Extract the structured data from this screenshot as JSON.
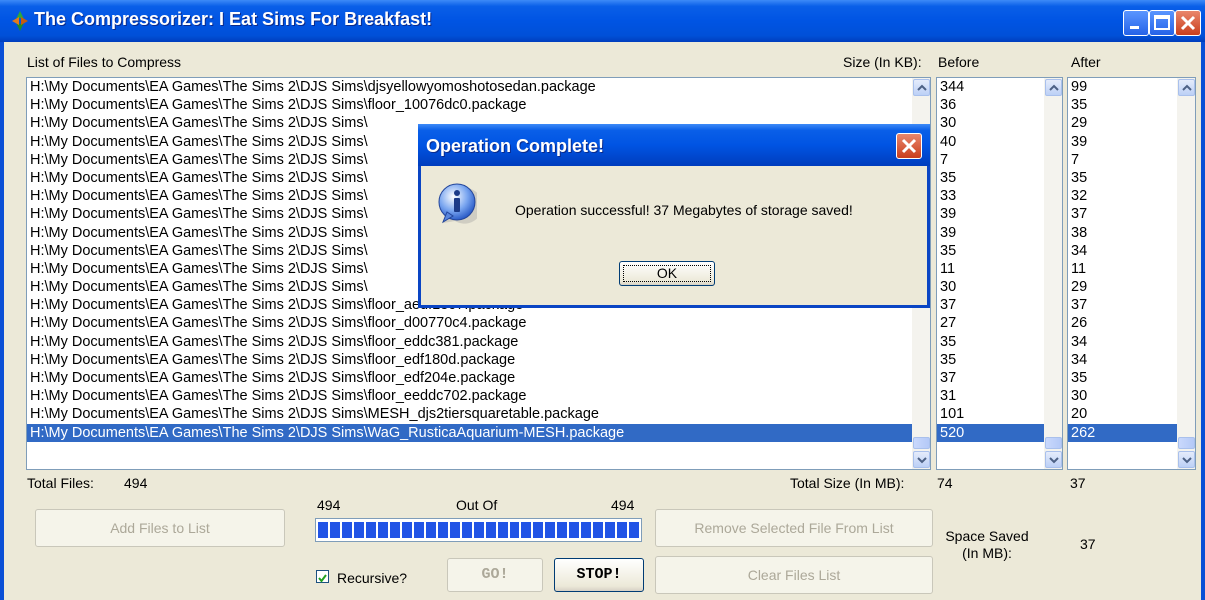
{
  "window": {
    "title": "The Compressorizer: I Eat Sims For Breakfast!"
  },
  "headers": {
    "files": "List of Files to Compress",
    "size": "Size (In KB):",
    "before": "Before",
    "after": "After"
  },
  "files": [
    "H:\\My Documents\\EA Games\\The Sims 2\\DJS Sims\\djsyellowyomoshotosedan.package",
    "H:\\My Documents\\EA Games\\The Sims 2\\DJS Sims\\floor_10076dc0.package",
    "H:\\My Documents\\EA Games\\The Sims 2\\DJS Sims\\",
    "H:\\My Documents\\EA Games\\The Sims 2\\DJS Sims\\",
    "H:\\My Documents\\EA Games\\The Sims 2\\DJS Sims\\",
    "H:\\My Documents\\EA Games\\The Sims 2\\DJS Sims\\",
    "H:\\My Documents\\EA Games\\The Sims 2\\DJS Sims\\",
    "H:\\My Documents\\EA Games\\The Sims 2\\DJS Sims\\",
    "H:\\My Documents\\EA Games\\The Sims 2\\DJS Sims\\",
    "H:\\My Documents\\EA Games\\The Sims 2\\DJS Sims\\",
    "H:\\My Documents\\EA Games\\The Sims 2\\DJS Sims\\",
    "H:\\My Documents\\EA Games\\The Sims 2\\DJS Sims\\",
    "H:\\My Documents\\EA Games\\The Sims 2\\DJS Sims\\floor_aedf1e07.package",
    "H:\\My Documents\\EA Games\\The Sims 2\\DJS Sims\\floor_d00770c4.package",
    "H:\\My Documents\\EA Games\\The Sims 2\\DJS Sims\\floor_eddc381.package",
    "H:\\My Documents\\EA Games\\The Sims 2\\DJS Sims\\floor_edf180d.package",
    "H:\\My Documents\\EA Games\\The Sims 2\\DJS Sims\\floor_edf204e.package",
    "H:\\My Documents\\EA Games\\The Sims 2\\DJS Sims\\floor_eeddc702.package",
    "H:\\My Documents\\EA Games\\The Sims 2\\DJS Sims\\MESH_djs2tiersquaretable.package",
    "H:\\My Documents\\EA Games\\The Sims 2\\DJS Sims\\WaG_RusticaAquarium-MESH.package"
  ],
  "before": [
    "344",
    "36",
    "30",
    "40",
    "7",
    "35",
    "33",
    "39",
    "39",
    "35",
    "11",
    "30",
    "37",
    "27",
    "35",
    "35",
    "37",
    "31",
    "101",
    "520"
  ],
  "after": [
    "99",
    "35",
    "29",
    "39",
    "7",
    "35",
    "32",
    "37",
    "38",
    "34",
    "11",
    "29",
    "37",
    "26",
    "34",
    "34",
    "35",
    "30",
    "20",
    "262"
  ],
  "selected_index": 19,
  "footer": {
    "total_files_label": "Total Files:",
    "total_files_value": "494",
    "total_size_label": "Total Size (In MB):",
    "total_before": "74",
    "total_after": "37",
    "progress_current": "494",
    "progress_of": "Out Of",
    "progress_total": "494",
    "progress_fraction": 1.0,
    "space_saved_label_1": "Space Saved",
    "space_saved_label_2": "(In MB):",
    "space_saved_value": "37"
  },
  "buttons": {
    "add": "Add Files to List",
    "remove": "Remove Selected File From List",
    "go": "GO!",
    "stop": "STOP!",
    "clear": "Clear Files List",
    "recursive": "Recursive?"
  },
  "recursive_checked": true,
  "dialog": {
    "title": "Operation Complete!",
    "message": "Operation successful! 37 Megabytes of storage saved!",
    "ok": "OK"
  }
}
